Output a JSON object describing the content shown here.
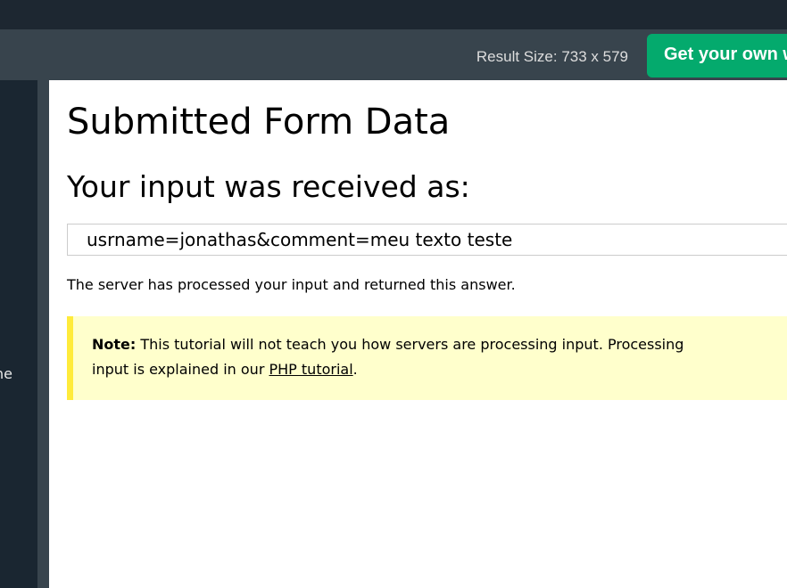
{
  "toolbar": {
    "result_size": "Result Size: 733 x 579",
    "get_own_label": "Get your own w"
  },
  "left_panel": {
    "partial_text": "ne"
  },
  "result": {
    "title": "Submitted Form Data",
    "subtitle": "Your input was received as:",
    "submitted_value": "usrname=jonathas&comment=meu texto teste",
    "server_answer": "The server has processed your input and returned this answer.",
    "note": {
      "label": "Note:",
      "line1": " This tutorial will not teach you how servers are processing input. Processing",
      "line2_before": "input is explained in our ",
      "link_text": "PHP tutorial",
      "line2_after": "."
    }
  },
  "colors": {
    "top_bar": "#1d2731",
    "toolbar": "#38444d",
    "button_green": "#04aa6d",
    "note_background": "#ffffcc",
    "note_border": "#ffeb3b"
  }
}
